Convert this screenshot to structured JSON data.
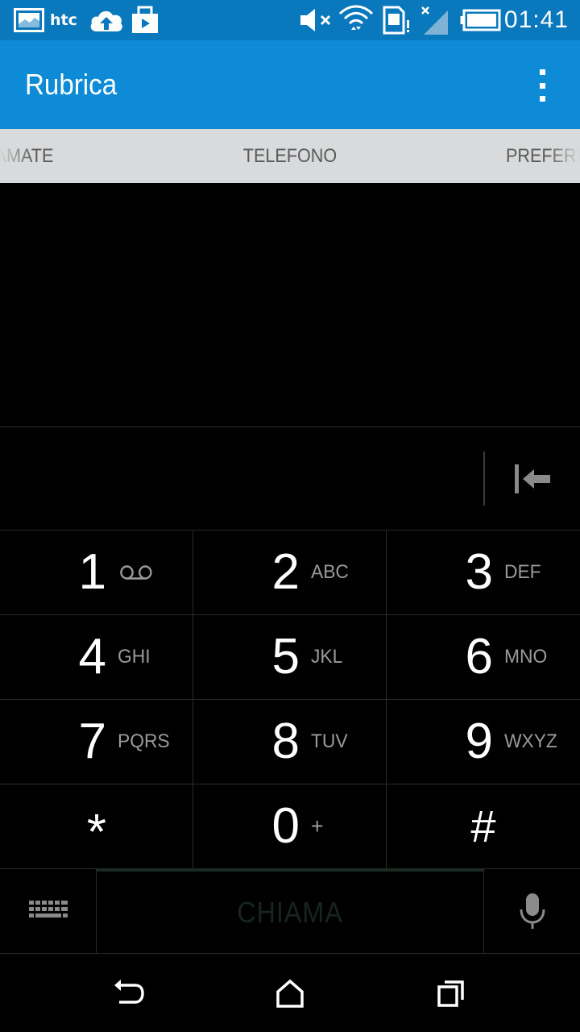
{
  "status_bar": {
    "carrier_label": "htc",
    "time": "01:41",
    "icons": [
      "gallery-icon",
      "cloud-upload-icon",
      "store-bag-icon",
      "muted-speaker-icon",
      "wifi-icon",
      "sim-card-icon",
      "signal-icon",
      "battery-icon"
    ]
  },
  "app_bar": {
    "title": "Rubrica",
    "overflow_icon": "overflow-menu-icon"
  },
  "tabs": {
    "left": "HIAMATE",
    "center": "TELEFONO",
    "right": "PREFERI"
  },
  "number_field": {
    "value": "",
    "backspace_icon": "backspace-icon"
  },
  "keypad": {
    "keys": [
      {
        "digit": "1",
        "letters": "",
        "extra": "voicemail-icon"
      },
      {
        "digit": "2",
        "letters": "ABC"
      },
      {
        "digit": "3",
        "letters": "DEF"
      },
      {
        "digit": "4",
        "letters": "GHI"
      },
      {
        "digit": "5",
        "letters": "JKL"
      },
      {
        "digit": "6",
        "letters": "MNO"
      },
      {
        "digit": "7",
        "letters": "PQRS"
      },
      {
        "digit": "8",
        "letters": "TUV"
      },
      {
        "digit": "9",
        "letters": "WXYZ"
      },
      {
        "digit": "*",
        "letters": ""
      },
      {
        "digit": "0",
        "letters": "+"
      },
      {
        "digit": "#",
        "letters": ""
      }
    ]
  },
  "action_bar": {
    "call_label": "CHIAMA",
    "keyboard_icon": "keyboard-icon",
    "mic_icon": "microphone-icon"
  },
  "nav_bar": {
    "icons": [
      "back-icon",
      "home-icon",
      "recents-icon"
    ]
  },
  "colors": {
    "status_bar": "#0a78bd",
    "app_bar": "#0e8bd6",
    "tab_bar": "#d9dadb",
    "background": "#000000",
    "call_label": "#17261d"
  }
}
